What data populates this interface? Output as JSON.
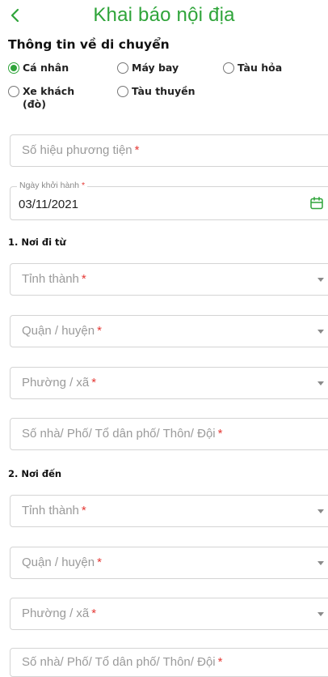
{
  "header": {
    "title": "Khai báo nội địa",
    "back_icon": "chevron-left-icon"
  },
  "section_title": "Thông tin về di chuyển",
  "transport_options": [
    {
      "label": "Cá nhân",
      "checked": true
    },
    {
      "label": "Máy bay",
      "checked": false
    },
    {
      "label": "Tàu hỏa",
      "checked": false
    },
    {
      "label": "Xe khách (đò)",
      "checked": false
    },
    {
      "label": "Tàu thuyền",
      "checked": false
    }
  ],
  "vehicle_number": {
    "placeholder": "Số hiệu phương tiện",
    "required_mark": "*"
  },
  "departure_date": {
    "label": "Ngày khởi hành",
    "required_mark": "*",
    "value": "03/11/2021",
    "icon": "calendar-icon"
  },
  "from_section": {
    "title": "1. Nơi đi từ",
    "province": {
      "placeholder": "Tỉnh thành",
      "required_mark": "*"
    },
    "district": {
      "placeholder": "Quận / huyện",
      "required_mark": "*"
    },
    "ward": {
      "placeholder": "Phường / xã",
      "required_mark": "*"
    },
    "address": {
      "placeholder": "Số nhà/ Phố/ Tổ dân phố/ Thôn/ Đội",
      "required_mark": "*"
    }
  },
  "to_section": {
    "title": "2. Nơi đến",
    "province": {
      "placeholder": "Tỉnh thành",
      "required_mark": "*"
    },
    "district": {
      "placeholder": "Quận / huyện",
      "required_mark": "*"
    },
    "ward": {
      "placeholder": "Phường / xã",
      "required_mark": "*"
    },
    "address": {
      "placeholder": "Số nhà/ Phố/ Tổ dân phố/ Thôn/ Đội",
      "required_mark": "*"
    }
  },
  "colors": {
    "accent": "#2fa43a",
    "required": "#e53935",
    "placeholder": "#9a9a9a",
    "border": "#d4d4d4"
  }
}
